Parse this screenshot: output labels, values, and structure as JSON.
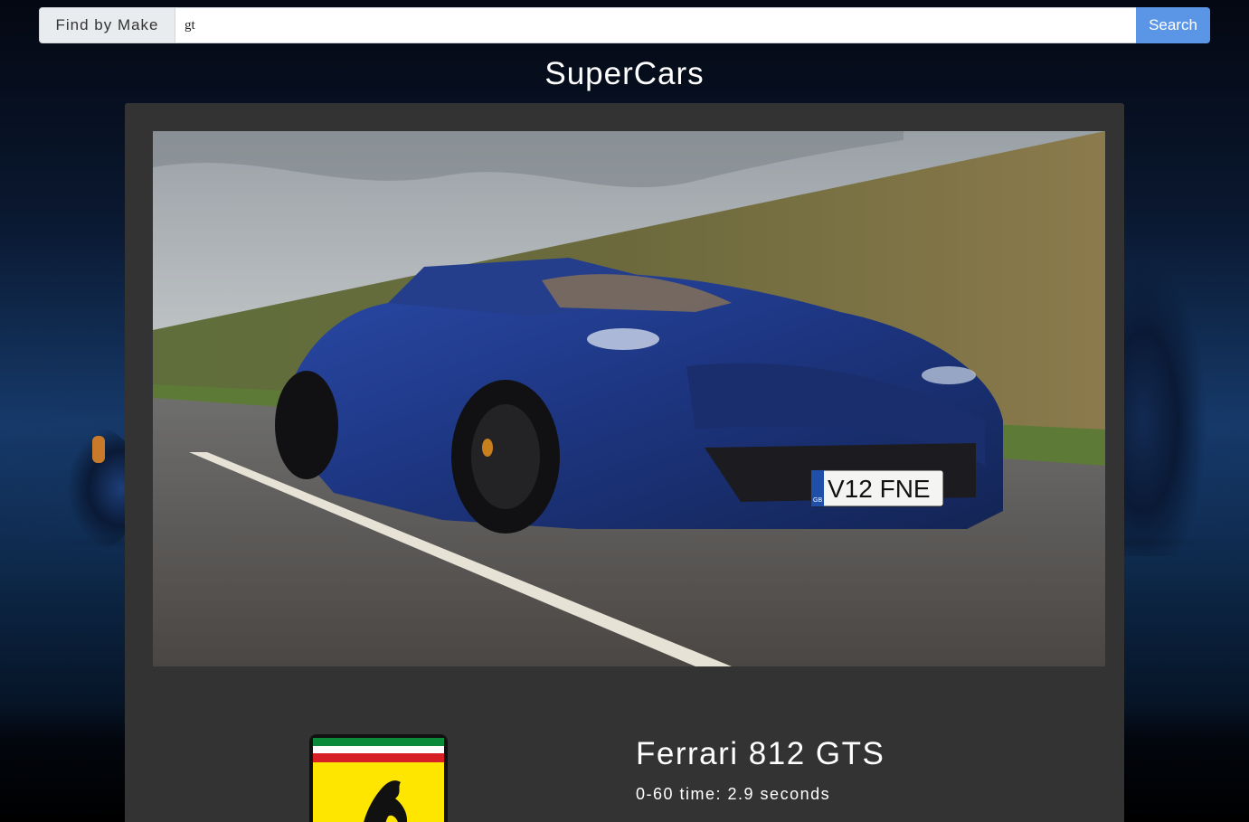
{
  "search": {
    "label": "Find by Make",
    "value": "gt",
    "button_label": "Search"
  },
  "header": {
    "title": "SuperCars"
  },
  "car": {
    "name": "Ferrari 812 GTS",
    "stat": "0-60 time: 2.9 seconds",
    "plate": "V12 FNE",
    "plate_region": "GB",
    "photo_icon": "sports-car-photo",
    "logo_icon": "ferrari-shield-logo"
  },
  "colors": {
    "accent": "#5b96e6",
    "card": "#333333",
    "car_blue": "#1f3a8a"
  }
}
